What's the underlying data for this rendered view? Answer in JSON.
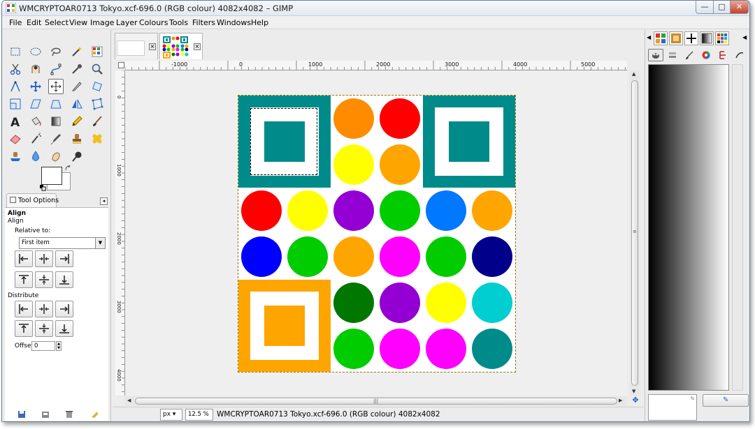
{
  "window": {
    "title": "WMCRYPTOAR0713 Tokyo.xcf-696.0 (RGB colour) 4082x4082 – GIMP",
    "controls": {
      "minimize": "—",
      "maximize": "□",
      "close": "✕"
    }
  },
  "menu": [
    "File",
    "Edit",
    "Select",
    "View",
    "Image",
    "Layer",
    "Colours",
    "Tools",
    "Filters",
    "Windows",
    "Help"
  ],
  "toolbox": {
    "active_tool": "move-tool",
    "tool_options_tab": "Tool Options",
    "options": {
      "heading": "Align",
      "subheading": "Align",
      "relative_label": "Relative to:",
      "relative_value": "First item",
      "distribute_label": "Distribute",
      "offset_label": "Offset:",
      "offset_value": "0"
    }
  },
  "ruler": {
    "h_labels": [
      "-1000",
      "0",
      "1000",
      "2000",
      "3000",
      "4000",
      "5000"
    ],
    "v_labels": [
      "0",
      "1000",
      "2000",
      "3000",
      "4000"
    ]
  },
  "statusbar": {
    "unit": "px",
    "zoom": "12.5 %",
    "text": "WMCRYPTOAR0713 Tokyo.xcf-696.0 (RGB colour) 4082x4082"
  },
  "colors": {
    "teal": "#008b8b",
    "orange": "#ffa500",
    "dark_orange": "#ff8c00",
    "red": "#ff0000",
    "yellow": "#ffff00",
    "purple": "#9400d3",
    "green": "#00cc00",
    "blue_azure": "#0078ff",
    "blue": "#0000ff",
    "magenta": "#ff00ff",
    "navy": "#00008b",
    "dark_green": "#007700",
    "cyan": "#00ced1"
  },
  "image_grid": {
    "squares": [
      {
        "cell": [
          0,
          0
        ],
        "color": "#008b8b"
      },
      {
        "cell": [
          4,
          0
        ],
        "color": "#008b8b"
      },
      {
        "cell": [
          0,
          4
        ],
        "color": "#ffa500"
      }
    ],
    "circles": [
      [
        "",
        "",
        "#ff8c00",
        "#ff0000",
        "",
        ""
      ],
      [
        "",
        "",
        "#ffff00",
        "#ffa500",
        "",
        ""
      ],
      [
        "#ff0000",
        "#ffff00",
        "#9400d3",
        "#00cc00",
        "#0078ff",
        "#ffa500"
      ],
      [
        "#0000ff",
        "#00cc00",
        "#ffa500",
        "#ff00ff",
        "#00cc00",
        "#00008b"
      ],
      [
        "",
        "",
        "#007700",
        "#9400d3",
        "#ffff00",
        "#00ced1"
      ],
      [
        "",
        "",
        "#00cc00",
        "#ff00ff",
        "#ff00ff",
        "#008b8b"
      ]
    ]
  }
}
